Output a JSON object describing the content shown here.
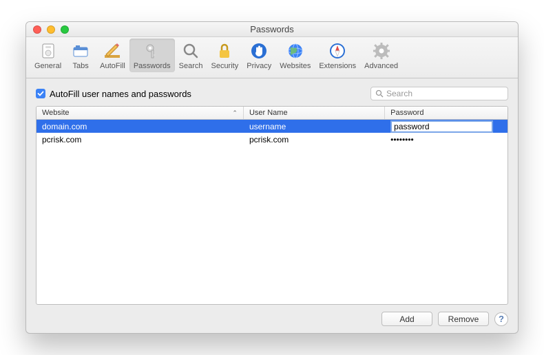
{
  "window": {
    "title": "Passwords"
  },
  "toolbar": {
    "items": [
      {
        "label": "General"
      },
      {
        "label": "Tabs"
      },
      {
        "label": "AutoFill"
      },
      {
        "label": "Passwords"
      },
      {
        "label": "Search"
      },
      {
        "label": "Security"
      },
      {
        "label": "Privacy"
      },
      {
        "label": "Websites"
      },
      {
        "label": "Extensions"
      },
      {
        "label": "Advanced"
      }
    ],
    "active_index": 3
  },
  "autofill": {
    "checked": true,
    "label": "AutoFill user names and passwords"
  },
  "search": {
    "placeholder": "Search"
  },
  "table": {
    "columns": {
      "website": "Website",
      "username": "User Name",
      "password": "Password"
    },
    "sort": {
      "column": "website",
      "dir": "asc"
    },
    "rows": [
      {
        "website": "domain.com",
        "username": "username",
        "password": "password",
        "selected": true,
        "editing_password": true
      },
      {
        "website": "pcrisk.com",
        "username": "pcrisk.com",
        "password": "••••••••",
        "selected": false,
        "editing_password": false
      }
    ]
  },
  "buttons": {
    "add": "Add",
    "remove": "Remove",
    "help": "?"
  }
}
